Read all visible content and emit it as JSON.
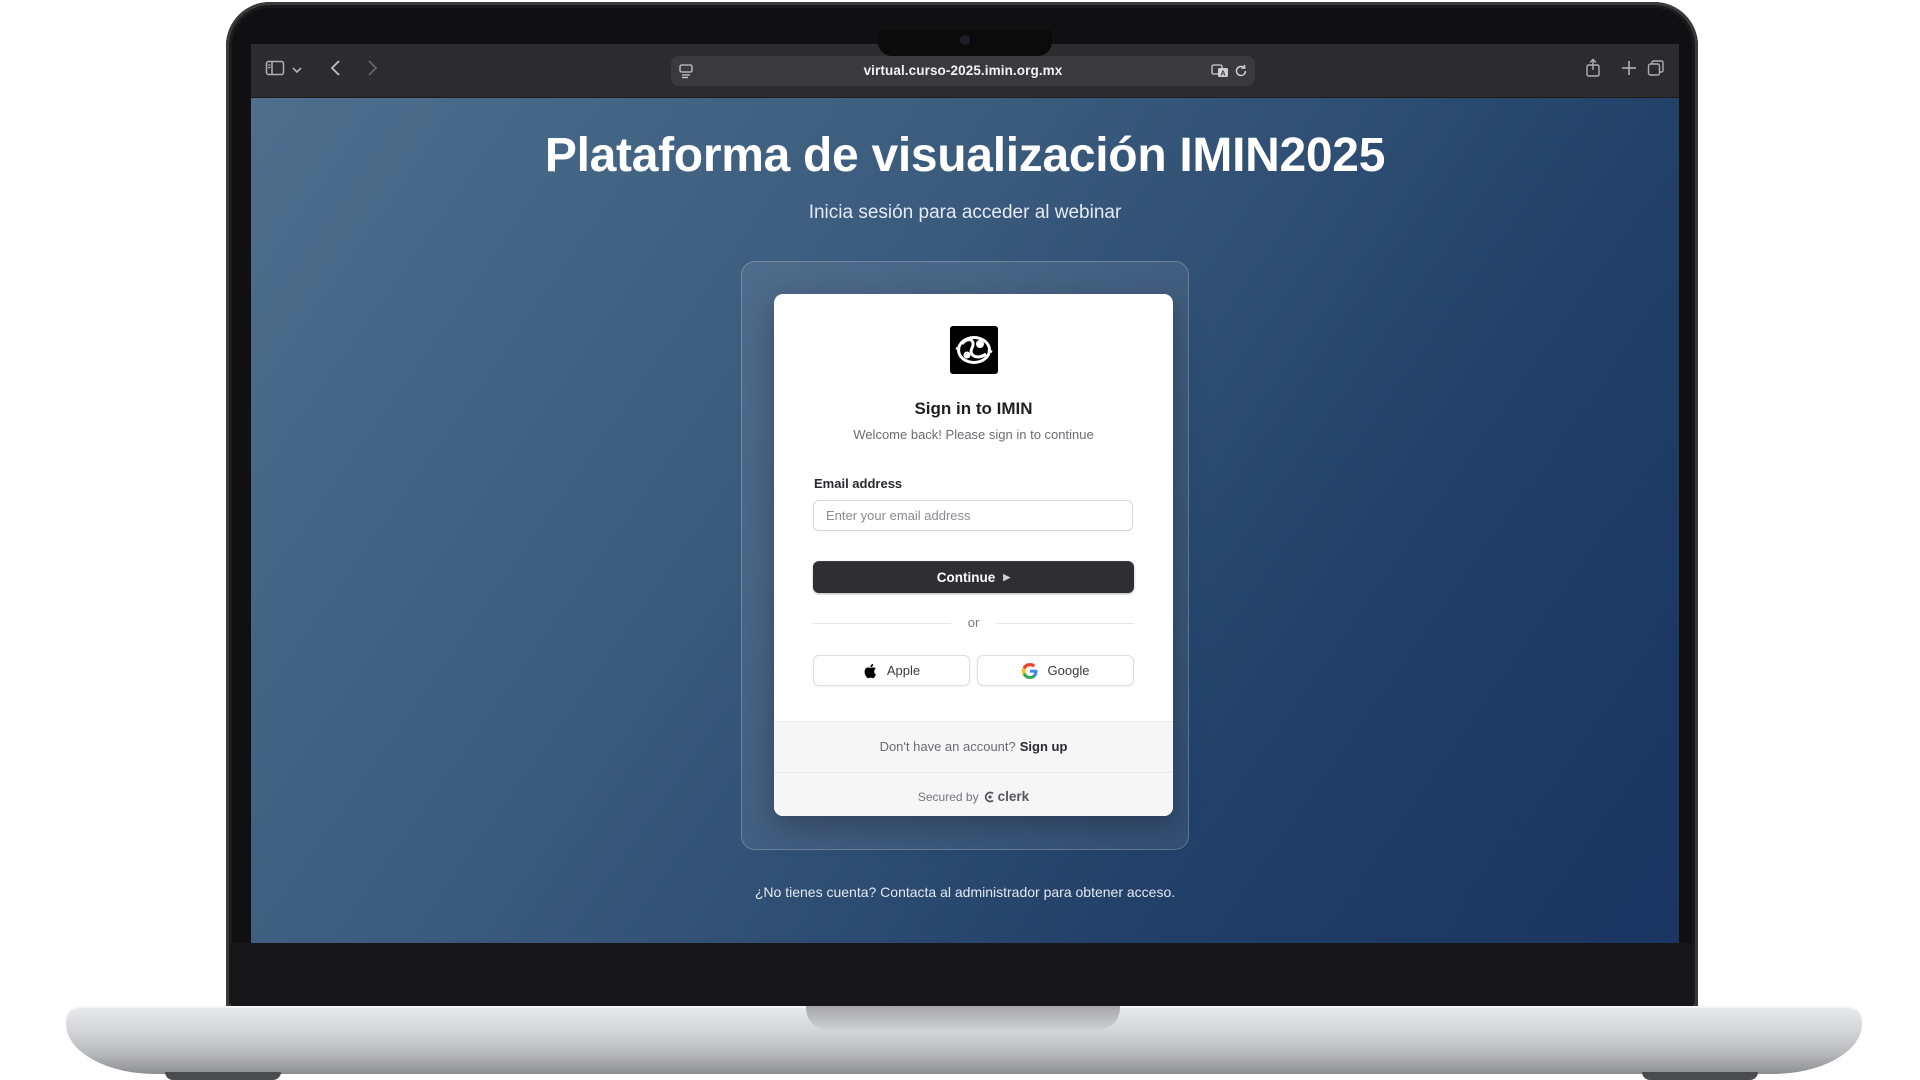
{
  "browser": {
    "url": "virtual.curso-2025.imin.org.mx"
  },
  "page": {
    "title": "Plataforma de visualización IMIN2025",
    "subtitle": "Inicia sesión para acceder al webinar",
    "bottom_note": "¿No tienes cuenta? Contacta al administrador para obtener acceso."
  },
  "signin": {
    "title": "Sign in to IMIN",
    "subtitle": "Welcome back! Please sign in to continue",
    "email_label": "Email address",
    "email_placeholder": "Enter your email address",
    "email_value": "",
    "continue_label": "Continue",
    "divider": "or",
    "apple_label": "Apple",
    "google_label": "Google",
    "no_account": "Don't have an account?",
    "signup_label": "Sign up",
    "secured_by": "Secured by",
    "clerk": "clerk"
  },
  "colors": {
    "bg_start": "#4e6e8c",
    "bg_end": "#1a3561",
    "button": "#2f2f33"
  }
}
